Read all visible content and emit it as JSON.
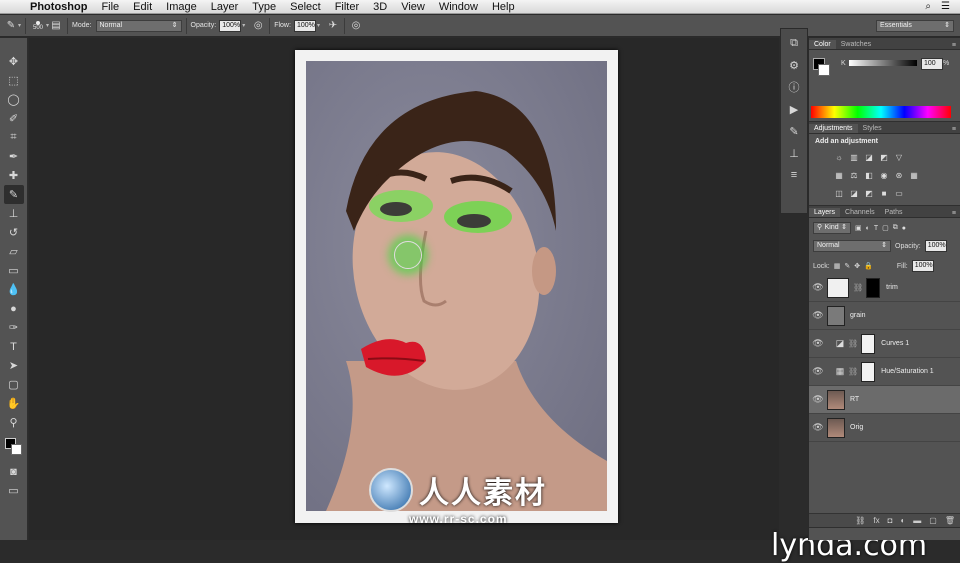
{
  "menubar": {
    "app": "Photoshop",
    "items": [
      "File",
      "Edit",
      "Image",
      "Layer",
      "Type",
      "Select",
      "Filter",
      "3D",
      "View",
      "Window",
      "Help"
    ]
  },
  "options": {
    "brush_size": "500",
    "mode_label": "Mode:",
    "mode_value": "Normal",
    "opacity_label": "Opacity:",
    "opacity_value": "100%",
    "flow_label": "Flow:",
    "flow_value": "100%",
    "workspace": "Essentials"
  },
  "color_panel": {
    "tabs": [
      "Color",
      "Swatches"
    ],
    "k_label": "K",
    "k_value": "100",
    "k_unit": "%"
  },
  "adjustments_panel": {
    "tabs": [
      "Adjustments",
      "Styles"
    ],
    "title": "Add an adjustment"
  },
  "layers_panel": {
    "tabs": [
      "Layers",
      "Channels",
      "Paths"
    ],
    "filter_value": "Kind",
    "blend_mode": "Normal",
    "opacity_label": "Opacity:",
    "opacity_value": "100%",
    "lock_label": "Lock:",
    "fill_label": "Fill:",
    "fill_value": "100%",
    "layers": [
      {
        "name": "trim"
      },
      {
        "name": "grain"
      },
      {
        "name": "Curves 1"
      },
      {
        "name": "Hue/Saturation 1"
      },
      {
        "name": "RT"
      },
      {
        "name": "Orig"
      }
    ]
  },
  "watermark": {
    "text": "人人素材",
    "url": "www.rr-sc.com"
  },
  "brand": "lynda.com",
  "colors": {
    "ui_panel": "#535353",
    "canvas_bg": "#282828",
    "brush_green": "#46dc46"
  }
}
